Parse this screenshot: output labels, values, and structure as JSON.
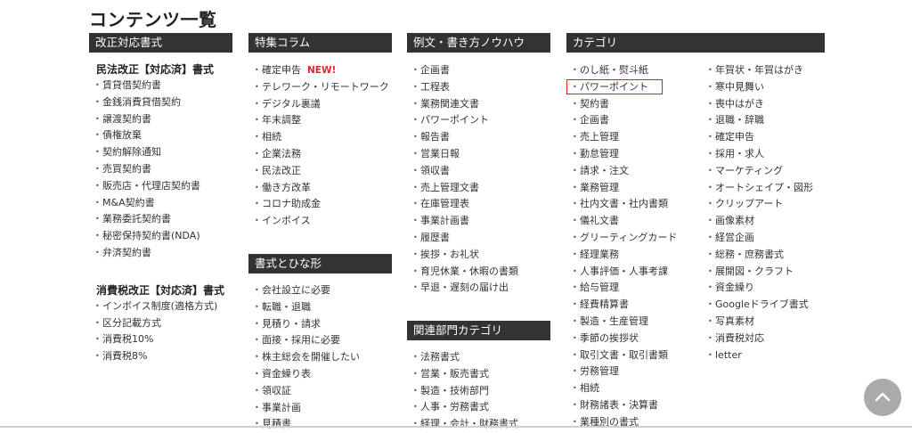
{
  "page_title": "コンテンツ一覧",
  "col1": {
    "header": "改正対応書式",
    "group1_title": "民法改正【対応済】書式",
    "group1_items": [
      "賃貸借契約書",
      "金銭消費貸借契約",
      "譲渡契約書",
      "債権放棄",
      "契約解除通知",
      "売買契約書",
      "販売店・代理店契約書",
      "M&A契約書",
      "業務委託契約書",
      "秘密保持契約書(NDA)",
      "弁済契約書"
    ],
    "group2_title": "消費税改正【対応済】書式",
    "group2_items": [
      "インボイス制度(適格方式)",
      "区分記載方式",
      "消費税10%",
      "消費税8%"
    ]
  },
  "col2": {
    "header1": "特集コラム",
    "items1": [
      "確定申告",
      "テレワーク・リモートワーク",
      "デジタル裏議",
      "年末調整",
      "相続",
      "企業法務",
      "民法改正",
      "働き方改革",
      "コロナ助成金",
      "インボイス"
    ],
    "new_badge": "NEW!",
    "header2": "書式とひな形",
    "items2": [
      "会社設立に必要",
      "転職・退職",
      "見積り・請求",
      "面接・採用に必要",
      "株主総会を開催したい",
      "資金繰り表",
      "領収証",
      "事業計画",
      "見積書"
    ]
  },
  "col3": {
    "header1": "例文・書き方ノウハウ",
    "items1": [
      "企画書",
      "工程表",
      "業務関連文書",
      "パワーポイント",
      "報告書",
      "営業日報",
      "領収書",
      "売上管理文書",
      "在庫管理表",
      "事業計画書",
      "履歴書",
      "挨拶・お礼状",
      "育児休業・休暇の書類",
      "早退・遅刻の届け出"
    ],
    "header2": "関連部門カテゴリ",
    "items2": [
      "法務書式",
      "営業・販売書式",
      "製造・技術部門",
      "人事・労務書式",
      "経理・会計・財務書式"
    ]
  },
  "col4": {
    "header": "カテゴリ",
    "items_left": [
      "のし紙・熨斗紙",
      "パワーポイント",
      "契約書",
      "企画書",
      "売上管理",
      "勤怠管理",
      "請求・注文",
      "業務管理",
      "社内文書・社内書類",
      "儀礼文書",
      "グリーティングカード",
      "経理業務",
      "人事評価・人事考課",
      "給与管理",
      "経費精算書",
      "製造・生産管理",
      "季節の挨拶状",
      "取引文書・取引書類",
      "労務管理",
      "相続",
      "財務諸表・決算書",
      "業種別の書式"
    ],
    "items_right": [
      "年賀状・年賀はがき",
      "寒中見舞い",
      "喪中はがき",
      "退職・辞職",
      "確定申告",
      "採用・求人",
      "マーケティング",
      "オートシェイプ・図形",
      "クリップアート",
      "画像素材",
      "経営企画",
      "総務・庶務書式",
      "展開図・クラフト",
      "資金繰り",
      "Googleドライブ書式",
      "写真素材",
      "消費税対応",
      "letter"
    ]
  },
  "highlight_color": "#e02020",
  "header_bg": "#333333",
  "scroll_icon": "chevron-up-icon"
}
